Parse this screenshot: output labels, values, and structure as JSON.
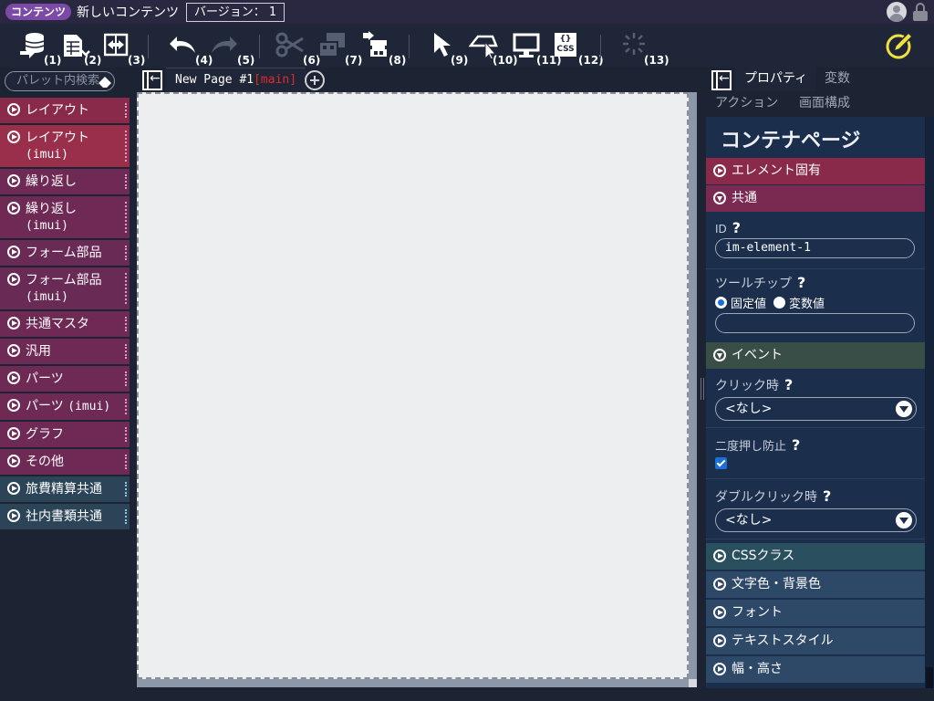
{
  "titlebar": {
    "badge": "コンテンツ",
    "title": "新しいコンテンツ",
    "version_label": "バージョン：",
    "version_number": "1"
  },
  "toolbar": {
    "numbers": [
      "(1)",
      "(2)",
      "(3)",
      "(4)",
      "(5)",
      "(6)",
      "(7)",
      "(8)",
      "(9)",
      "(10)",
      "(11)",
      "(12)",
      "(13)"
    ],
    "css_label": "CSS",
    "css_brace": "{}"
  },
  "palette": {
    "search_placeholder": "パレット内検索",
    "items": [
      {
        "label": "レイアウト",
        "sub": ""
      },
      {
        "label": "レイアウト",
        "sub": "(imui)"
      },
      {
        "label": "繰り返し",
        "sub": ""
      },
      {
        "label": "繰り返し",
        "sub": "(imui)"
      },
      {
        "label": "フォーム部品",
        "sub": ""
      },
      {
        "label": "フォーム部品",
        "sub": "(imui)"
      },
      {
        "label": "共通マスタ",
        "sub": ""
      },
      {
        "label": "汎用",
        "sub": ""
      },
      {
        "label": "パーツ",
        "sub": ""
      },
      {
        "label": "パーツ",
        "sub": "(imui)"
      },
      {
        "label": "グラフ",
        "sub": ""
      },
      {
        "label": "その他",
        "sub": ""
      },
      {
        "label": "旅費精算共通",
        "sub": ""
      },
      {
        "label": "社内書類共通",
        "sub": ""
      }
    ]
  },
  "editor": {
    "tab_label": "New Page #1",
    "tab_branch": "[main]"
  },
  "props": {
    "tabs_row1": [
      "プロパティ",
      "変数"
    ],
    "tabs_row2": [
      "アクション",
      "画面構成"
    ],
    "heading": "コンテナページ",
    "sections": {
      "element_specific": "エレメント固有",
      "common": "共通",
      "event": "イベント",
      "css_class": "CSSクラス",
      "colors": "文字色・背景色",
      "font": "フォント",
      "text_style": "テキストスタイル",
      "size": "幅・高さ"
    },
    "fields": {
      "id_label": "ID",
      "id_value": "im-element-1",
      "tooltip_label": "ツールチップ",
      "radio_fixed": "固定値",
      "radio_variable": "変数値",
      "tooltip_value": "",
      "click_label": "クリック時",
      "click_value": "<なし>",
      "double_prevent_label": "二度押し防止",
      "double_click_label": "ダブルクリック時",
      "double_click_value": "<なし>",
      "help": "?"
    }
  }
}
